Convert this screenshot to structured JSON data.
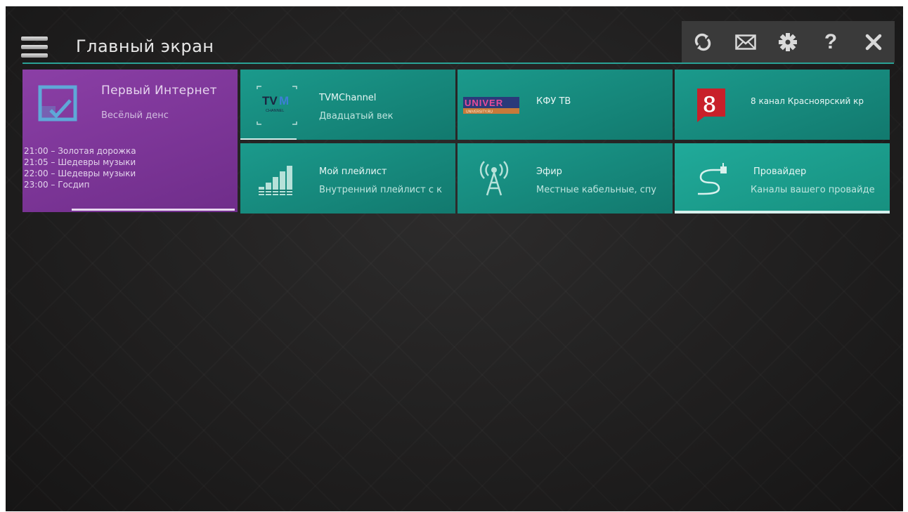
{
  "header": {
    "title": "Главный экран",
    "toolbar": {
      "refresh_icon": "refresh-icon",
      "mail_icon": "mail-icon",
      "settings_icon": "gear-icon",
      "help_icon": "question-icon",
      "close_icon": "close-icon"
    }
  },
  "featured": {
    "channel_name": "Первый Интернет",
    "now_playing": "Весёлый денс",
    "schedule": [
      "21:00 – Золотая дорожка",
      "21:05 – Шедевры музыки",
      "22:00 – Шедевры музыки",
      "23:00 – Госдип"
    ],
    "color": "#7b3698"
  },
  "tiles": {
    "tvm": {
      "title": "TVMChannel",
      "subtitle": "Двадцатый век",
      "logo_text": "TVM",
      "logo_sub": "CHANNEL"
    },
    "kfu": {
      "title": "КФУ ТВ",
      "subtitle": "",
      "logo_text": "UNIVER",
      "logo_sub": "UNIVERSITY.RU"
    },
    "eight": {
      "title": "8 канал Красноярский кр",
      "subtitle": "",
      "logo_text": "8"
    },
    "playlist": {
      "title": "Мой плейлист",
      "subtitle": "Внутренний плейлист с к"
    },
    "efir": {
      "title": "Эфир",
      "subtitle": "Местные кабельные, спу"
    },
    "provider": {
      "title": "Провайдер",
      "subtitle": "Каналы вашего провайде"
    }
  },
  "colors": {
    "accent": "#2aa296",
    "tile": "#16887b",
    "featured": "#7b3698",
    "toolbar": "#3a3a3a"
  }
}
